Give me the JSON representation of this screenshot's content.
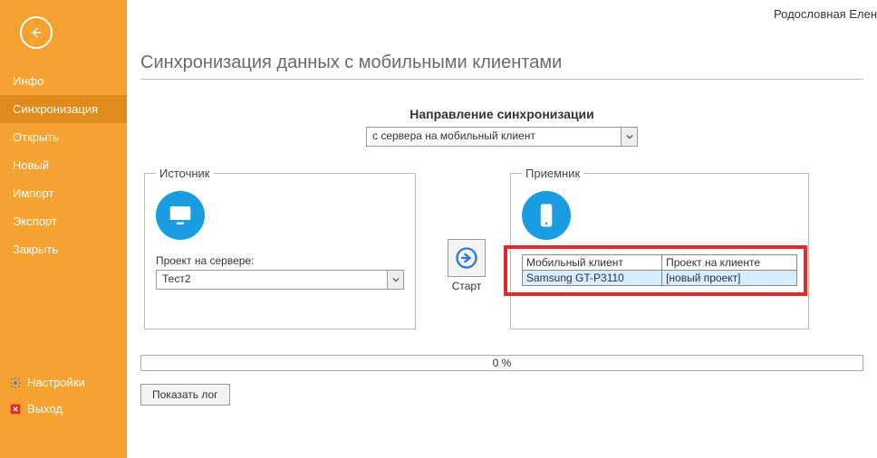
{
  "header": {
    "right_text": "Родословная Елен"
  },
  "page_title": "Синхронизация данных с мобильными клиентами",
  "sidebar": {
    "items": [
      {
        "label": "Инфо"
      },
      {
        "label": "Синхронизация"
      },
      {
        "label": "Открыть"
      },
      {
        "label": "Новый"
      },
      {
        "label": "Импорт"
      },
      {
        "label": "Экспорт"
      },
      {
        "label": "Закрыть"
      }
    ],
    "settings_label": "Настройки",
    "exit_label": "Выход"
  },
  "direction": {
    "label": "Направление синхронизации",
    "value": "с сервера на мобильный клиент"
  },
  "source": {
    "legend": "Источник",
    "project_label": "Проект на сервере:",
    "project_value": "Тест2"
  },
  "dest": {
    "legend": "Приемник",
    "col1": "Мобильный клиент",
    "col2": "Проект на клиенте",
    "row_client": "Samsung GT-P3110",
    "row_project": "[новый проект]"
  },
  "start_label": "Старт",
  "progress_text": "0 %",
  "log_button": "Показать лог"
}
